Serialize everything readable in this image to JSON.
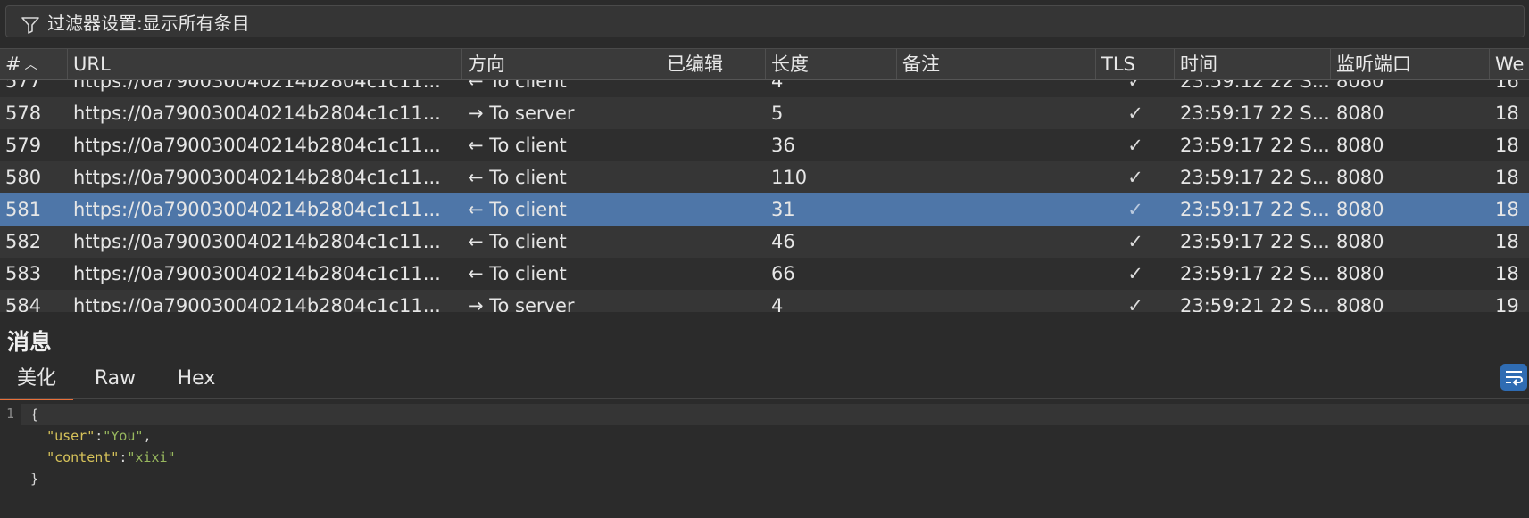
{
  "filter": {
    "icon": "filter-icon",
    "label": "过滤器设置:显示所有条目"
  },
  "table": {
    "columns": [
      {
        "key": "num",
        "label": "#"
      },
      {
        "key": "url",
        "label": "URL"
      },
      {
        "key": "direction",
        "label": "方向"
      },
      {
        "key": "edited",
        "label": "已编辑"
      },
      {
        "key": "length",
        "label": "长度"
      },
      {
        "key": "comment",
        "label": "备注"
      },
      {
        "key": "tls",
        "label": "TLS"
      },
      {
        "key": "time",
        "label": "时间"
      },
      {
        "key": "port",
        "label": "监听端口"
      },
      {
        "key": "we",
        "label": "We"
      }
    ],
    "sort_icon": "chevron-up-icon",
    "rows": [
      {
        "num": "577",
        "url": "https://0a790030040214b2804c1c11...",
        "direction": "← To client",
        "edited": "",
        "length": "4",
        "comment": "",
        "tls": "✓",
        "time": "23:59:12 22 S...",
        "port": "8080",
        "we": "16",
        "selected": false
      },
      {
        "num": "578",
        "url": "https://0a790030040214b2804c1c11...",
        "direction": "→ To server",
        "edited": "",
        "length": "5",
        "comment": "",
        "tls": "✓",
        "time": "23:59:17 22 S...",
        "port": "8080",
        "we": "18",
        "selected": false
      },
      {
        "num": "579",
        "url": "https://0a790030040214b2804c1c11...",
        "direction": "← To client",
        "edited": "",
        "length": "36",
        "comment": "",
        "tls": "✓",
        "time": "23:59:17 22 S...",
        "port": "8080",
        "we": "18",
        "selected": false
      },
      {
        "num": "580",
        "url": "https://0a790030040214b2804c1c11...",
        "direction": "← To client",
        "edited": "",
        "length": "110",
        "comment": "",
        "tls": "✓",
        "time": "23:59:17 22 S...",
        "port": "8080",
        "we": "18",
        "selected": false
      },
      {
        "num": "581",
        "url": "https://0a790030040214b2804c1c11...",
        "direction": "← To client",
        "edited": "",
        "length": "31",
        "comment": "",
        "tls": "✓",
        "time": "23:59:17 22 S...",
        "port": "8080",
        "we": "18",
        "selected": true
      },
      {
        "num": "582",
        "url": "https://0a790030040214b2804c1c11...",
        "direction": "← To client",
        "edited": "",
        "length": "46",
        "comment": "",
        "tls": "✓",
        "time": "23:59:17 22 S...",
        "port": "8080",
        "we": "18",
        "selected": false
      },
      {
        "num": "583",
        "url": "https://0a790030040214b2804c1c11...",
        "direction": "← To client",
        "edited": "",
        "length": "66",
        "comment": "",
        "tls": "✓",
        "time": "23:59:17 22 S...",
        "port": "8080",
        "we": "18",
        "selected": false
      },
      {
        "num": "584",
        "url": "https://0a790030040214b2804c1c11...",
        "direction": "→ To server",
        "edited": "",
        "length": "4",
        "comment": "",
        "tls": "✓",
        "time": "23:59:21 22 S...",
        "port": "8080",
        "we": "19",
        "selected": false
      }
    ]
  },
  "message": {
    "title": "消息",
    "tabs": [
      {
        "label": "美化",
        "active": true
      },
      {
        "label": "Raw",
        "active": false
      },
      {
        "label": "Hex",
        "active": false
      }
    ],
    "wrap_icon": "word-wrap-icon",
    "editor": {
      "line_numbers": [
        "1"
      ],
      "lines": [
        [
          {
            "t": "{",
            "c": "plain"
          }
        ],
        [
          {
            "t": "  ",
            "c": "plain"
          },
          {
            "t": "\"user\"",
            "c": "key"
          },
          {
            "t": ":",
            "c": "plain"
          },
          {
            "t": "\"You\"",
            "c": "str"
          },
          {
            "t": ",",
            "c": "plain"
          }
        ],
        [
          {
            "t": "  ",
            "c": "plain"
          },
          {
            "t": "\"content\"",
            "c": "key"
          },
          {
            "t": ":",
            "c": "plain"
          },
          {
            "t": "\"xixi\"",
            "c": "str"
          }
        ],
        [
          {
            "t": "}",
            "c": "plain"
          }
        ]
      ]
    }
  }
}
